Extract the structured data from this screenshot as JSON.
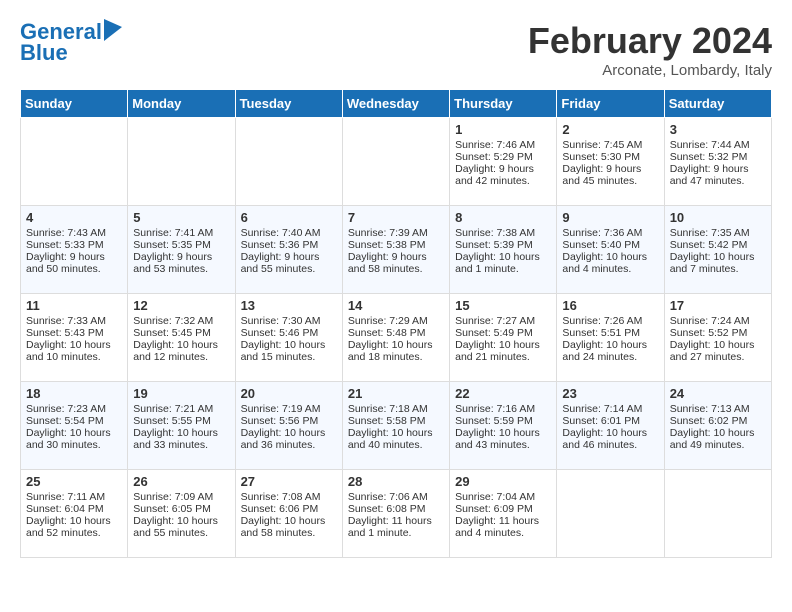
{
  "header": {
    "logo_line1": "General",
    "logo_line2": "Blue",
    "month_title": "February 2024",
    "subtitle": "Arconate, Lombardy, Italy"
  },
  "weekdays": [
    "Sunday",
    "Monday",
    "Tuesday",
    "Wednesday",
    "Thursday",
    "Friday",
    "Saturday"
  ],
  "weeks": [
    [
      {
        "day": "",
        "info": ""
      },
      {
        "day": "",
        "info": ""
      },
      {
        "day": "",
        "info": ""
      },
      {
        "day": "",
        "info": ""
      },
      {
        "day": "1",
        "info": "Sunrise: 7:46 AM\nSunset: 5:29 PM\nDaylight: 9 hours\nand 42 minutes."
      },
      {
        "day": "2",
        "info": "Sunrise: 7:45 AM\nSunset: 5:30 PM\nDaylight: 9 hours\nand 45 minutes."
      },
      {
        "day": "3",
        "info": "Sunrise: 7:44 AM\nSunset: 5:32 PM\nDaylight: 9 hours\nand 47 minutes."
      }
    ],
    [
      {
        "day": "4",
        "info": "Sunrise: 7:43 AM\nSunset: 5:33 PM\nDaylight: 9 hours\nand 50 minutes."
      },
      {
        "day": "5",
        "info": "Sunrise: 7:41 AM\nSunset: 5:35 PM\nDaylight: 9 hours\nand 53 minutes."
      },
      {
        "day": "6",
        "info": "Sunrise: 7:40 AM\nSunset: 5:36 PM\nDaylight: 9 hours\nand 55 minutes."
      },
      {
        "day": "7",
        "info": "Sunrise: 7:39 AM\nSunset: 5:38 PM\nDaylight: 9 hours\nand 58 minutes."
      },
      {
        "day": "8",
        "info": "Sunrise: 7:38 AM\nSunset: 5:39 PM\nDaylight: 10 hours\nand 1 minute."
      },
      {
        "day": "9",
        "info": "Sunrise: 7:36 AM\nSunset: 5:40 PM\nDaylight: 10 hours\nand 4 minutes."
      },
      {
        "day": "10",
        "info": "Sunrise: 7:35 AM\nSunset: 5:42 PM\nDaylight: 10 hours\nand 7 minutes."
      }
    ],
    [
      {
        "day": "11",
        "info": "Sunrise: 7:33 AM\nSunset: 5:43 PM\nDaylight: 10 hours\nand 10 minutes."
      },
      {
        "day": "12",
        "info": "Sunrise: 7:32 AM\nSunset: 5:45 PM\nDaylight: 10 hours\nand 12 minutes."
      },
      {
        "day": "13",
        "info": "Sunrise: 7:30 AM\nSunset: 5:46 PM\nDaylight: 10 hours\nand 15 minutes."
      },
      {
        "day": "14",
        "info": "Sunrise: 7:29 AM\nSunset: 5:48 PM\nDaylight: 10 hours\nand 18 minutes."
      },
      {
        "day": "15",
        "info": "Sunrise: 7:27 AM\nSunset: 5:49 PM\nDaylight: 10 hours\nand 21 minutes."
      },
      {
        "day": "16",
        "info": "Sunrise: 7:26 AM\nSunset: 5:51 PM\nDaylight: 10 hours\nand 24 minutes."
      },
      {
        "day": "17",
        "info": "Sunrise: 7:24 AM\nSunset: 5:52 PM\nDaylight: 10 hours\nand 27 minutes."
      }
    ],
    [
      {
        "day": "18",
        "info": "Sunrise: 7:23 AM\nSunset: 5:54 PM\nDaylight: 10 hours\nand 30 minutes."
      },
      {
        "day": "19",
        "info": "Sunrise: 7:21 AM\nSunset: 5:55 PM\nDaylight: 10 hours\nand 33 minutes."
      },
      {
        "day": "20",
        "info": "Sunrise: 7:19 AM\nSunset: 5:56 PM\nDaylight: 10 hours\nand 36 minutes."
      },
      {
        "day": "21",
        "info": "Sunrise: 7:18 AM\nSunset: 5:58 PM\nDaylight: 10 hours\nand 40 minutes."
      },
      {
        "day": "22",
        "info": "Sunrise: 7:16 AM\nSunset: 5:59 PM\nDaylight: 10 hours\nand 43 minutes."
      },
      {
        "day": "23",
        "info": "Sunrise: 7:14 AM\nSunset: 6:01 PM\nDaylight: 10 hours\nand 46 minutes."
      },
      {
        "day": "24",
        "info": "Sunrise: 7:13 AM\nSunset: 6:02 PM\nDaylight: 10 hours\nand 49 minutes."
      }
    ],
    [
      {
        "day": "25",
        "info": "Sunrise: 7:11 AM\nSunset: 6:04 PM\nDaylight: 10 hours\nand 52 minutes."
      },
      {
        "day": "26",
        "info": "Sunrise: 7:09 AM\nSunset: 6:05 PM\nDaylight: 10 hours\nand 55 minutes."
      },
      {
        "day": "27",
        "info": "Sunrise: 7:08 AM\nSunset: 6:06 PM\nDaylight: 10 hours\nand 58 minutes."
      },
      {
        "day": "28",
        "info": "Sunrise: 7:06 AM\nSunset: 6:08 PM\nDaylight: 11 hours\nand 1 minute."
      },
      {
        "day": "29",
        "info": "Sunrise: 7:04 AM\nSunset: 6:09 PM\nDaylight: 11 hours\nand 4 minutes."
      },
      {
        "day": "",
        "info": ""
      },
      {
        "day": "",
        "info": ""
      }
    ]
  ]
}
